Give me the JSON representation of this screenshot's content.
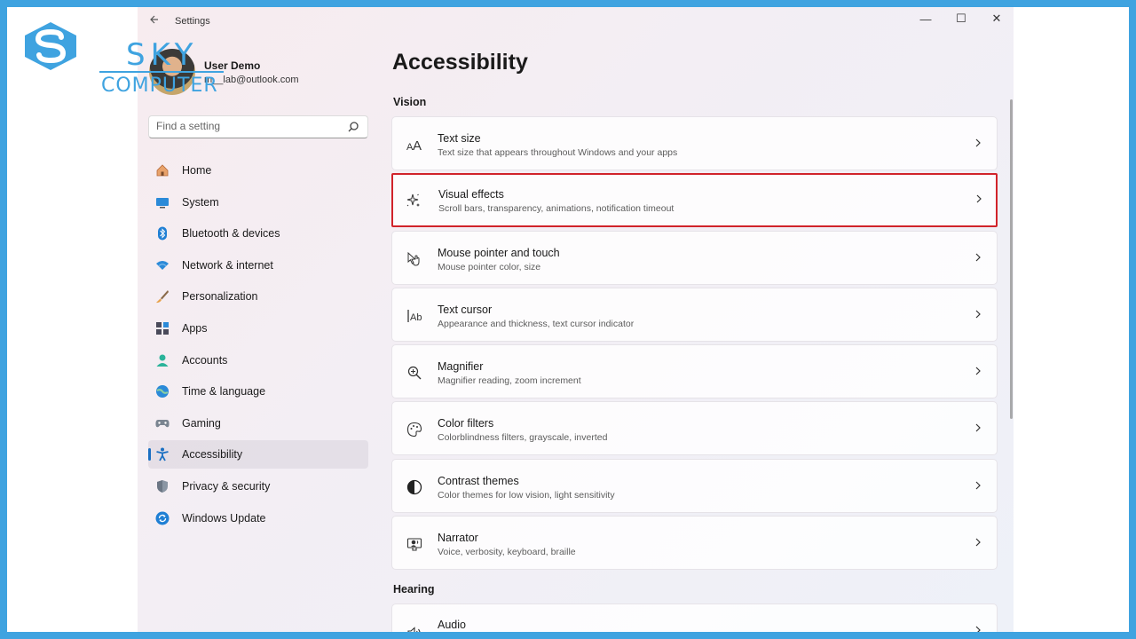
{
  "app": {
    "title": "Settings",
    "controls": {
      "minimize": "—",
      "maximize": "☐",
      "close": "✕"
    }
  },
  "watermark": {
    "line1": "SKY",
    "line2": "COMPUTER"
  },
  "user": {
    "name": "User Demo",
    "email": "m__lab@outlook.com"
  },
  "search": {
    "placeholder": "Find a setting"
  },
  "nav": {
    "items": [
      {
        "label": "Home",
        "icon": "home-icon"
      },
      {
        "label": "System",
        "icon": "monitor-icon"
      },
      {
        "label": "Bluetooth & devices",
        "icon": "bluetooth-icon"
      },
      {
        "label": "Network & internet",
        "icon": "wifi-icon"
      },
      {
        "label": "Personalization",
        "icon": "brush-icon"
      },
      {
        "label": "Apps",
        "icon": "apps-icon"
      },
      {
        "label": "Accounts",
        "icon": "person-icon"
      },
      {
        "label": "Time & language",
        "icon": "globe-clock-icon"
      },
      {
        "label": "Gaming",
        "icon": "gamepad-icon"
      },
      {
        "label": "Accessibility",
        "icon": "accessibility-icon",
        "active": true
      },
      {
        "label": "Privacy & security",
        "icon": "shield-icon"
      },
      {
        "label": "Windows Update",
        "icon": "update-icon"
      }
    ]
  },
  "main": {
    "title": "Accessibility",
    "sections": {
      "vision": "Vision",
      "hearing": "Hearing"
    },
    "vision_items": [
      {
        "title": "Text size",
        "desc": "Text size that appears throughout Windows and your apps",
        "icon": "text-size-icon"
      },
      {
        "title": "Visual effects",
        "desc": "Scroll bars, transparency, animations, notification timeout",
        "icon": "sparkle-icon",
        "highlighted": true
      },
      {
        "title": "Mouse pointer and touch",
        "desc": "Mouse pointer color, size",
        "icon": "pointer-icon"
      },
      {
        "title": "Text cursor",
        "desc": "Appearance and thickness, text cursor indicator",
        "icon": "text-cursor-icon"
      },
      {
        "title": "Magnifier",
        "desc": "Magnifier reading, zoom increment",
        "icon": "magnifier-icon"
      },
      {
        "title": "Color filters",
        "desc": "Colorblindness filters, grayscale, inverted",
        "icon": "palette-icon"
      },
      {
        "title": "Contrast themes",
        "desc": "Color themes for low vision, light sensitivity",
        "icon": "contrast-icon"
      },
      {
        "title": "Narrator",
        "desc": "Voice, verbosity, keyboard, braille",
        "icon": "narrator-icon"
      }
    ],
    "hearing_items": [
      {
        "title": "Audio",
        "icon": "speaker-icon"
      }
    ]
  },
  "colors": {
    "frame": "#3fa3e0",
    "highlight": "#d1232a",
    "accent": "#1a6fc2"
  }
}
